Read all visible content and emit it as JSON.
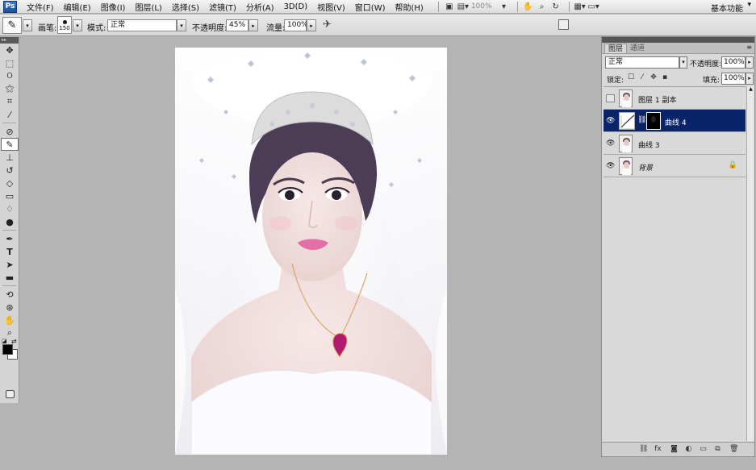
{
  "menubar": {
    "logo": "Ps",
    "items": [
      "文件(F)",
      "编辑(E)",
      "图像(I)",
      "图层(L)",
      "选择(S)",
      "滤镜(T)",
      "分析(A)",
      "3D(D)",
      "视图(V)",
      "窗口(W)",
      "帮助(H)"
    ],
    "zoom": "100%",
    "workspace": "基本功能"
  },
  "options": {
    "brush_label": "画笔:",
    "brush_size": "150",
    "mode_label": "模式:",
    "mode_value": "正常",
    "opacity_label": "不透明度:",
    "opacity_value": "45%",
    "flow_label": "流量:",
    "flow_value": "100%"
  },
  "layers_panel": {
    "tabs": [
      "图层",
      "通道"
    ],
    "blend_mode": "正常",
    "opacity_label": "不透明度:",
    "opacity_value": "100%",
    "lock_label": "锁定:",
    "fill_label": "填充:",
    "fill_value": "100%",
    "layers": [
      {
        "name": "图层 1 副本",
        "visible": false,
        "selected": false,
        "type": "pixel"
      },
      {
        "name": "曲线 4",
        "visible": true,
        "selected": true,
        "type": "adjustment"
      },
      {
        "name": "曲线 3",
        "visible": true,
        "selected": false,
        "type": "pixel"
      },
      {
        "name": "背景",
        "visible": true,
        "selected": false,
        "type": "background"
      }
    ],
    "selected_color": "#0a246a"
  }
}
